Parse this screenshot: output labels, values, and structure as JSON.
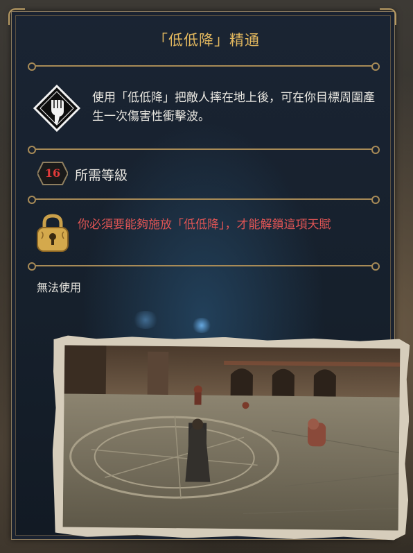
{
  "talent": {
    "title": "「低低降」精通",
    "description": "使用「低低降」把敵人摔在地上後，可在你目標周圍產生一次傷害性衝擊波。",
    "spell_icon": "hand-pointing-down-icon"
  },
  "requirement": {
    "level": "16",
    "label": "所需等級",
    "lock_icon": "golden-padlock-icon",
    "lock_message": "你必須要能夠施放「低低降」，才能解鎖這項天賦"
  },
  "status": "無法使用",
  "preview": {
    "image": "arena-combat-preview-image"
  },
  "colors": {
    "title": "#e1b75e",
    "body_text": "#e8e6e0",
    "warning_text": "#e15555",
    "divider": "#a88b57",
    "panel": "#1a2433"
  }
}
